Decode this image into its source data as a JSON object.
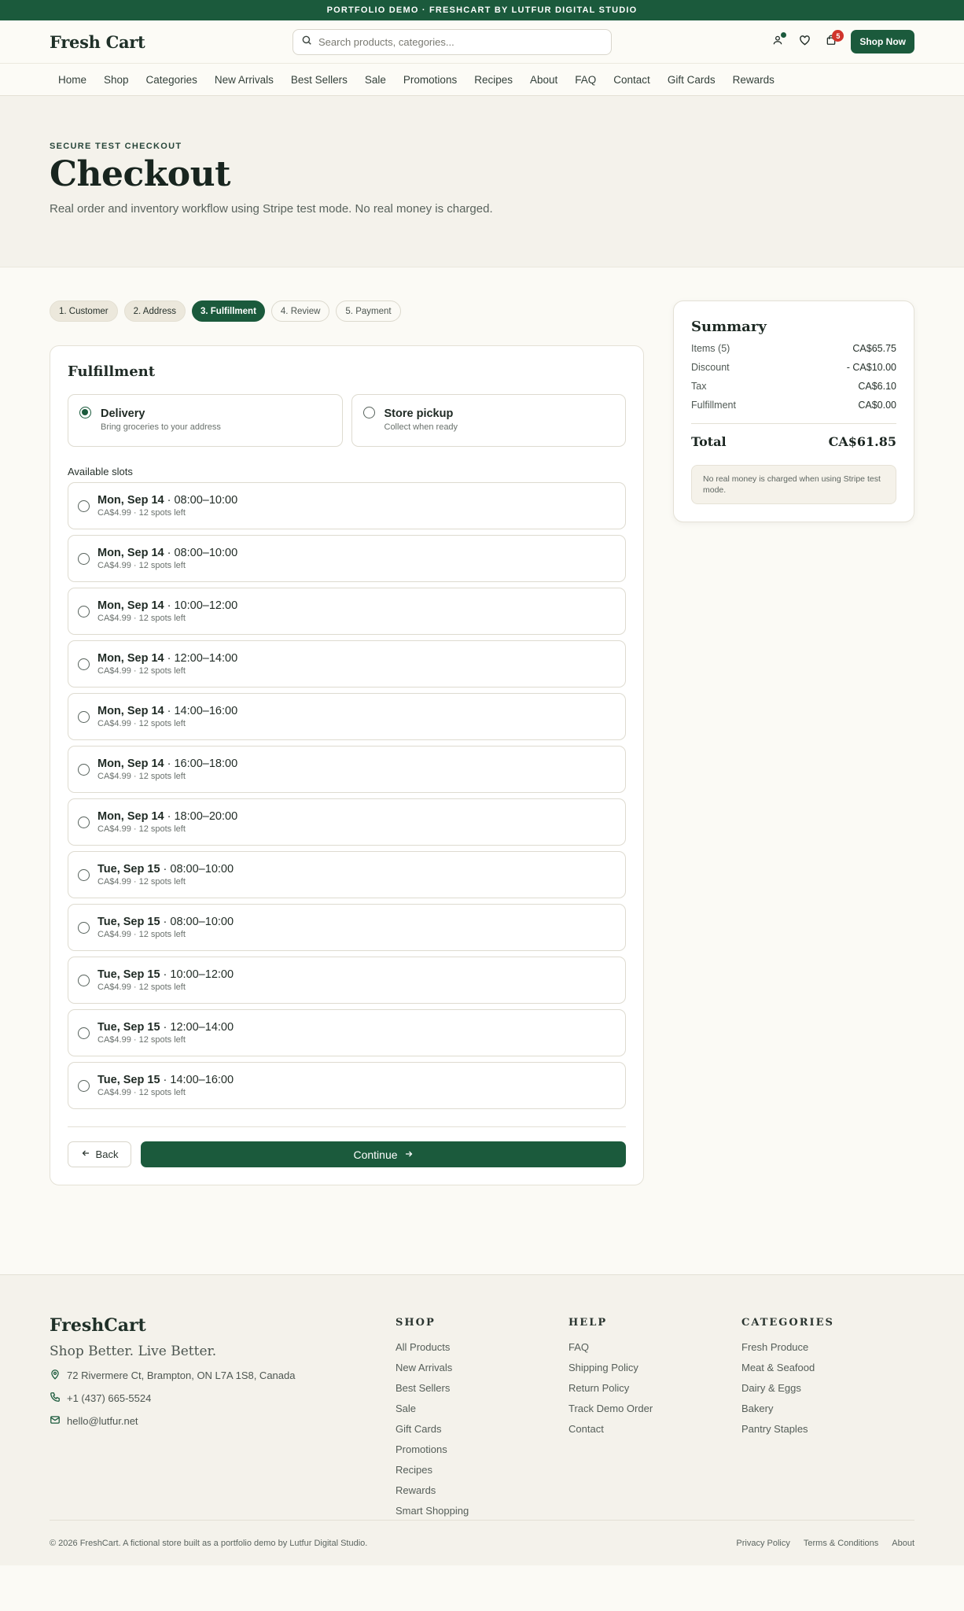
{
  "announce": "PORTFOLIO DEMO · FRESHCART BY LUTFUR DIGITAL STUDIO",
  "header": {
    "logo": "Fresh Cart",
    "search_placeholder": "Search products, categories...",
    "cart_count": "5",
    "shop_now": "Shop Now"
  },
  "nav": [
    "Home",
    "Shop",
    "Categories",
    "New Arrivals",
    "Best Sellers",
    "Sale",
    "Promotions",
    "Recipes",
    "About",
    "FAQ",
    "Contact",
    "Gift Cards",
    "Rewards"
  ],
  "hero": {
    "eyebrow": "SECURE TEST CHECKOUT",
    "title": "Checkout",
    "subtitle": "Real order and inventory workflow using Stripe test mode. No real money is charged."
  },
  "steps": [
    {
      "label": "1. Customer",
      "state": "done"
    },
    {
      "label": "2. Address",
      "state": "done"
    },
    {
      "label": "3. Fulfillment",
      "state": "active"
    },
    {
      "label": "4. Review",
      "state": "todo"
    },
    {
      "label": "5. Payment",
      "state": "todo"
    }
  ],
  "fulfillment": {
    "title": "Fulfillment",
    "modes": [
      {
        "name": "Delivery",
        "sub": "Bring groceries to your address",
        "selected": true
      },
      {
        "name": "Store pickup",
        "sub": "Collect when ready",
        "selected": false
      }
    ],
    "slots_label": "Available slots",
    "slots": [
      {
        "day": "Mon, Sep 14",
        "time": " · 08:00–10:00",
        "sub": "CA$4.99 · 12 spots left"
      },
      {
        "day": "Mon, Sep 14",
        "time": " · 08:00–10:00",
        "sub": "CA$4.99 · 12 spots left"
      },
      {
        "day": "Mon, Sep 14",
        "time": " · 10:00–12:00",
        "sub": "CA$4.99 · 12 spots left"
      },
      {
        "day": "Mon, Sep 14",
        "time": " · 12:00–14:00",
        "sub": "CA$4.99 · 12 spots left"
      },
      {
        "day": "Mon, Sep 14",
        "time": " · 14:00–16:00",
        "sub": "CA$4.99 · 12 spots left"
      },
      {
        "day": "Mon, Sep 14",
        "time": " · 16:00–18:00",
        "sub": "CA$4.99 · 12 spots left"
      },
      {
        "day": "Mon, Sep 14",
        "time": " · 18:00–20:00",
        "sub": "CA$4.99 · 12 spots left"
      },
      {
        "day": "Tue, Sep 15",
        "time": " · 08:00–10:00",
        "sub": "CA$4.99 · 12 spots left"
      },
      {
        "day": "Tue, Sep 15",
        "time": " · 08:00–10:00",
        "sub": "CA$4.99 · 12 spots left"
      },
      {
        "day": "Tue, Sep 15",
        "time": " · 10:00–12:00",
        "sub": "CA$4.99 · 12 spots left"
      },
      {
        "day": "Tue, Sep 15",
        "time": " · 12:00–14:00",
        "sub": "CA$4.99 · 12 spots left"
      },
      {
        "day": "Tue, Sep 15",
        "time": " · 14:00–16:00",
        "sub": "CA$4.99 · 12 spots left"
      }
    ],
    "back": "Back",
    "continue": "Continue"
  },
  "summary": {
    "title": "Summary",
    "rows": [
      {
        "label": "Items (5)",
        "value": "CA$65.75"
      },
      {
        "label": "Discount",
        "value": "- CA$10.00"
      },
      {
        "label": "Tax",
        "value": "CA$6.10"
      },
      {
        "label": "Fulfillment",
        "value": "CA$0.00"
      }
    ],
    "total_label": "Total",
    "total_value": "CA$61.85",
    "note": "No real money is charged when using Stripe test mode."
  },
  "footer": {
    "logo": "FreshCart",
    "tagline": "Shop Better. Live Better.",
    "address": "72 Rivermere Ct, Brampton, ON L7A 1S8, Canada",
    "phone": "+1 (437) 665-5524",
    "email": "hello@lutfur.net",
    "columns": [
      {
        "title": "SHOP",
        "links": [
          "All Products",
          "New Arrivals",
          "Best Sellers",
          "Sale",
          "Gift Cards",
          "Promotions",
          "Recipes",
          "Rewards",
          "Smart Shopping"
        ]
      },
      {
        "title": "HELP",
        "links": [
          "FAQ",
          "Shipping Policy",
          "Return Policy",
          "Track Demo Order",
          "Contact"
        ]
      },
      {
        "title": "CATEGORIES",
        "links": [
          "Fresh Produce",
          "Meat & Seafood",
          "Dairy & Eggs",
          "Bakery",
          "Pantry Staples"
        ]
      }
    ],
    "copyright": "© 2026 FreshCart. A fictional store built as a portfolio demo by Lutfur Digital Studio.",
    "legal": [
      "Privacy Policy",
      "Terms & Conditions",
      "About"
    ]
  },
  "colors": {
    "brand": "#1b5a3c",
    "badge": "#d0342c"
  }
}
